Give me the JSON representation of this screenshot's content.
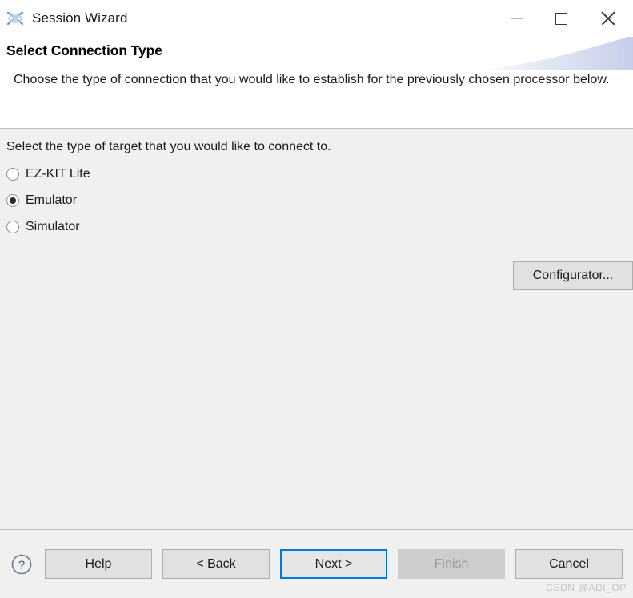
{
  "window": {
    "title": "Session Wizard",
    "icon": "session-wizard-icon",
    "controls": {
      "minimize": "minimize-icon",
      "maximize": "maximize-icon",
      "close": "close-icon"
    }
  },
  "header": {
    "title": "Select Connection Type",
    "description": "Choose the type of connection that you would like to establish for the previously chosen processor below."
  },
  "content": {
    "prompt": "Select the type of target that you would like to connect to.",
    "options": [
      {
        "label": "EZ-KIT Lite",
        "selected": false
      },
      {
        "label": "Emulator",
        "selected": true
      },
      {
        "label": "Simulator",
        "selected": false
      }
    ],
    "configurator_label": "Configurator..."
  },
  "buttonbar": {
    "help_icon": "help-circle-icon",
    "buttons": [
      {
        "label": "Help",
        "state": "enabled"
      },
      {
        "label": "< Back",
        "state": "enabled"
      },
      {
        "label": "Next >",
        "state": "default"
      },
      {
        "label": "Finish",
        "state": "disabled"
      },
      {
        "label": "Cancel",
        "state": "enabled"
      }
    ]
  },
  "watermark": "CSDN @ADI_OP",
  "colors": {
    "accent": "#0078d7",
    "dialog_background": "#f0f0f0",
    "header_background": "#ffffff",
    "swoosh": "#ccd4ec",
    "disabled_text": "#9a9a9a",
    "watermark_text": "#c3c3c3"
  }
}
